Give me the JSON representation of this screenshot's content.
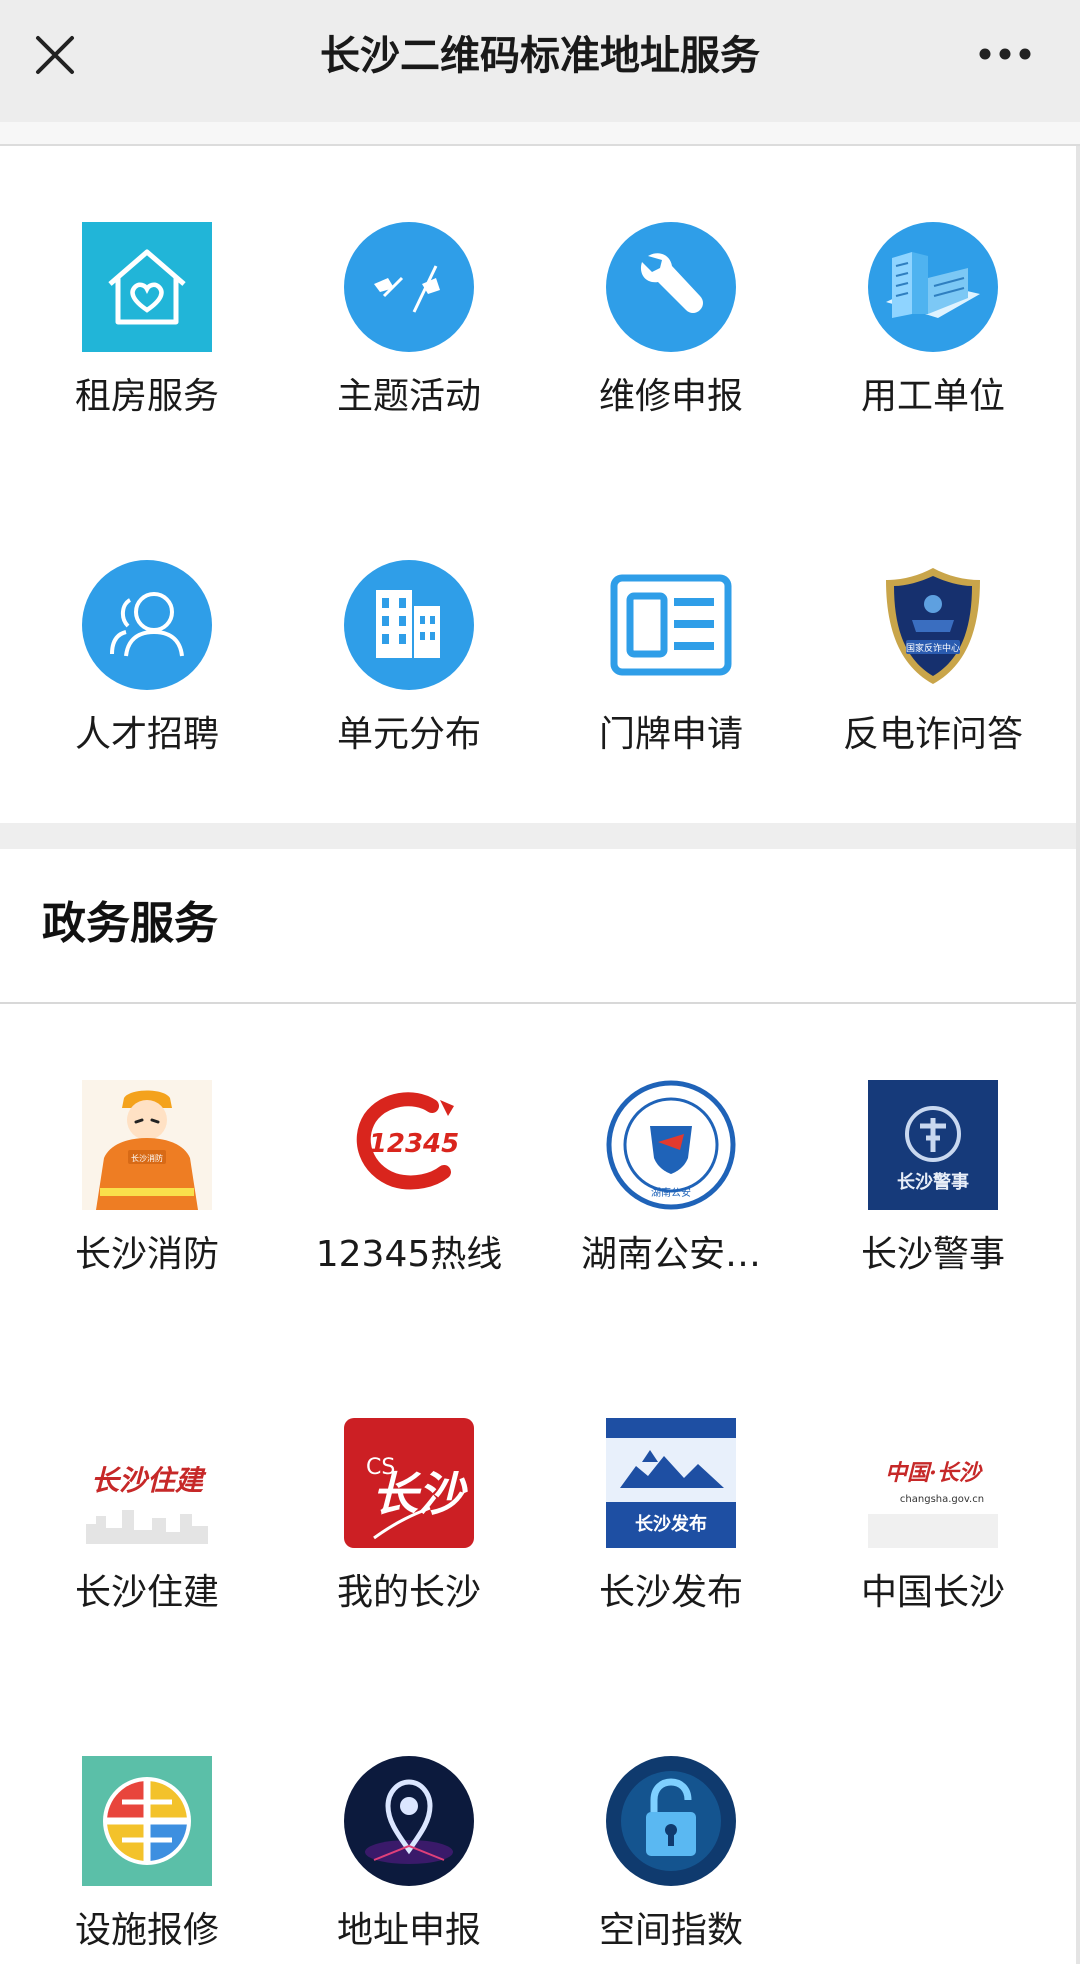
{
  "titlebar": {
    "title": "长沙二维码标准地址服务"
  },
  "top_grid": [
    {
      "label": "租房服务",
      "icon": "house-heart-icon"
    },
    {
      "label": "主题活动",
      "icon": "flags-icon"
    },
    {
      "label": "维修申报",
      "icon": "wrench-icon"
    },
    {
      "label": "用工单位",
      "icon": "building-icon"
    },
    {
      "label": "人才招聘",
      "icon": "people-icon"
    },
    {
      "label": "单元分布",
      "icon": "apartment-icon"
    },
    {
      "label": "门牌申请",
      "icon": "doorplate-icon"
    },
    {
      "label": "反电诈问答",
      "icon": "anti-fraud-shield-icon"
    }
  ],
  "gov_section": {
    "title": "政务服务",
    "items": [
      {
        "label": "长沙消防",
        "icon": "firefighter-icon"
      },
      {
        "label": "12345热线",
        "icon": "hotline-12345-icon"
      },
      {
        "label": "湖南公安…",
        "icon": "police-badge-icon"
      },
      {
        "label": "长沙警事",
        "icon": "police-emblem-icon"
      },
      {
        "label": "长沙住建",
        "icon": "housing-construction-icon"
      },
      {
        "label": "我的长沙",
        "icon": "my-changsha-icon"
      },
      {
        "label": "长沙发布",
        "icon": "changsha-release-icon"
      },
      {
        "label": "中国长沙",
        "icon": "china-changsha-icon"
      },
      {
        "label": "设施报修",
        "icon": "facility-repair-icon"
      },
      {
        "label": "地址申报",
        "icon": "location-pin-icon"
      },
      {
        "label": "空间指数",
        "icon": "padlock-icon"
      }
    ]
  },
  "icon_texts": {
    "hotline_number": "12345",
    "police_badge_text": "湖南公安",
    "police_emblem_text": "长沙警事",
    "housing_text": "长沙住建",
    "my_cs_letters": "CS",
    "my_cs_text": "长沙",
    "release_text": "长沙发布",
    "china_cs_text": "中国·长沙",
    "china_cs_url": "changsha.gov.cn",
    "fire_text": "长沙消防",
    "anti_fraud_text": "国家反诈中心"
  },
  "colors": {
    "titlebar_bg": "#ededed",
    "icon_blue": "#2f9ee8",
    "icon_teal": "#21b5d8",
    "band_gray": "#eeeeee"
  }
}
